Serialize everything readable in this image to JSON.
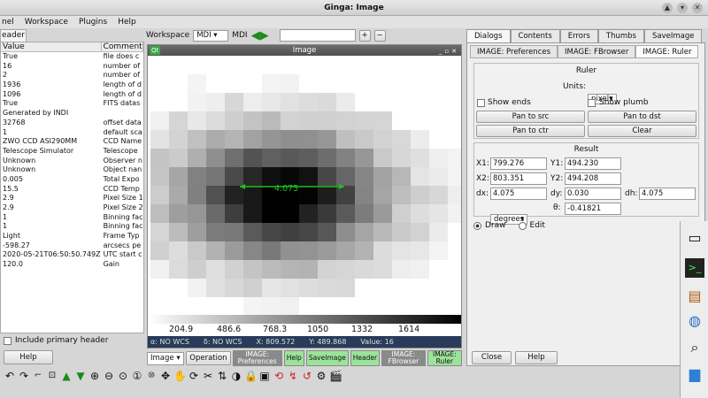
{
  "window": {
    "title": "Ginga: Image",
    "btn_up": "▲",
    "btn_min": "▾",
    "btn_close": "✕"
  },
  "menu": [
    "nel",
    "Workspace",
    "Plugins",
    "Help"
  ],
  "left": {
    "tab": "eader",
    "col_value": "Value",
    "col_comment": "Comment",
    "rows": [
      {
        "v": "True",
        "c": "file does c"
      },
      {
        "v": "16",
        "c": "number of"
      },
      {
        "v": "2",
        "c": "number of"
      },
      {
        "v": "1936",
        "c": "length of d"
      },
      {
        "v": "1096",
        "c": "length of d"
      },
      {
        "v": "True",
        "c": "FITS datas"
      },
      {
        "v": "Generated by INDI",
        "c": ""
      },
      {
        "v": "32768",
        "c": "offset data"
      },
      {
        "v": "1",
        "c": "default sca"
      },
      {
        "v": "ZWO CCD ASI290MM",
        "c": "CCD Name"
      },
      {
        "v": "Telescope Simulator",
        "c": "Telescope"
      },
      {
        "v": "Unknown",
        "c": "Observer n"
      },
      {
        "v": "Unknown",
        "c": "Object nan"
      },
      {
        "v": "0.005",
        "c": "Total Expo"
      },
      {
        "v": "15.5",
        "c": "CCD Temp"
      },
      {
        "v": "2.9",
        "c": "Pixel Size 1"
      },
      {
        "v": "2.9",
        "c": "Pixel Size 2"
      },
      {
        "v": "1",
        "c": "Binning fac"
      },
      {
        "v": "1",
        "c": "Binning fac"
      },
      {
        "v": "Light",
        "c": "Frame Typ"
      },
      {
        "v": "-598.27",
        "c": "arcsecs pe"
      },
      {
        "v": "2020-05-21T06:50:50.749Z",
        "c": "UTC start c"
      },
      {
        "v": "120.0",
        "c": "Gain"
      }
    ],
    "include_primary": "Include primary header",
    "help": "Help"
  },
  "workspace": {
    "label": "Workspace",
    "value": "MDI",
    "mdi_label": "MDI"
  },
  "image_window": {
    "qt": "Qt",
    "title": "Image",
    "ruler_text": "4.075",
    "colorbar_ticks": [
      "204.9",
      "486.6",
      "768.3",
      "1050",
      "1332",
      "1614"
    ],
    "status": {
      "ra": "α: NO WCS",
      "dec": "δ: NO WCS",
      "x": "X: 809.572",
      "y": "Y: 489.868",
      "value": "Value: 16"
    }
  },
  "opbar": {
    "mode": "Image",
    "operation": "Operation",
    "tabs": [
      {
        "label": "IMAGE: Preferences",
        "active": false
      },
      {
        "label": "Help",
        "active": true
      },
      {
        "label": "SaveImage",
        "active": true
      },
      {
        "label": "Header",
        "active": true
      },
      {
        "label": "IMAGE: FBrowser",
        "active": false
      },
      {
        "label": "IMAGE: Ruler",
        "active": true
      }
    ]
  },
  "right": {
    "tabs": [
      {
        "label": "Dialogs",
        "active": true
      },
      {
        "label": "Contents",
        "active": false
      },
      {
        "label": "Errors",
        "active": false
      },
      {
        "label": "Thumbs",
        "active": false
      },
      {
        "label": "SaveImage",
        "active": false
      }
    ],
    "subtabs": [
      {
        "label": "IMAGE: Preferences",
        "active": false
      },
      {
        "label": "IMAGE: FBrowser",
        "active": false
      },
      {
        "label": "IMAGE: Ruler",
        "active": true
      }
    ],
    "ruler": {
      "title": "Ruler",
      "units_label": "Units:",
      "units_value": "pixels",
      "show_ends": "Show ends",
      "show_plumb": "Show plumb",
      "pan_src": "Pan to src",
      "pan_dst": "Pan to dst",
      "pan_ctr": "Pan to ctr",
      "clear": "Clear"
    },
    "result": {
      "title": "Result",
      "x1_label": "X1:",
      "x1": "799.276",
      "y1_label": "Y1:",
      "y1": "494.230",
      "x2_label": "X2:",
      "x2": "803.351",
      "y2_label": "Y2:",
      "y2": "494.208",
      "dx_label": "dx:",
      "dx": "4.075",
      "dy_label": "dy:",
      "dy": "0.030",
      "dh_label": "dh:",
      "dh": "4.075",
      "angle_units": "degrees",
      "theta_label": "θ:",
      "theta": "-0.41821"
    },
    "draw": "Draw",
    "edit": "Edit",
    "close": "Close",
    "help": "Help"
  }
}
